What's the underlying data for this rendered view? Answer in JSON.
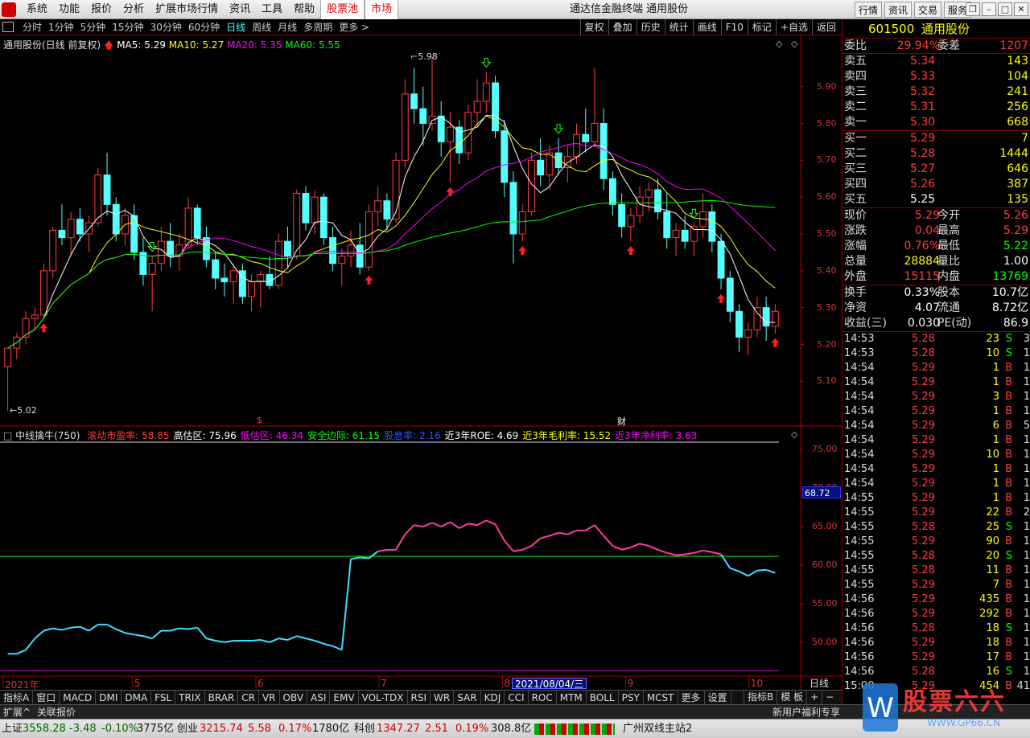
{
  "menu": {
    "items": [
      "系统",
      "功能",
      "报价",
      "分析",
      "扩展市场行情",
      "资讯",
      "工具",
      "帮助",
      "股票池",
      "市场"
    ],
    "red_items": [
      "股票池",
      "市场"
    ],
    "app_title": "通达信金融终端  通用股份",
    "right_buttons": [
      "行情",
      "资讯",
      "交易",
      "服务"
    ],
    "window_controls": [
      "restore-icon",
      "minimize-icon",
      "maximize-icon",
      "close-icon"
    ]
  },
  "periods": [
    "分时",
    "1分钟",
    "5分钟",
    "15分钟",
    "30分钟",
    "60分钟",
    "日线",
    "周线",
    "月线",
    "多周期",
    "更多 >"
  ],
  "active_period": "日线",
  "right_tools": [
    "复权",
    "叠加",
    "历史",
    "统计",
    "画线",
    "F10",
    "标记",
    "+自选",
    "返回"
  ],
  "chart_header": {
    "title": "通用股份(日线 前复权)",
    "ma5_label": "MA5: 5.29",
    "ma10_label": "MA10: 5.27",
    "ma20_label": "MA20: 5.35",
    "ma60_label": "MA60: 5.55",
    "colors": {
      "ma5": "#ffffff",
      "ma10": "#ffff00",
      "ma20": "#ff00ff",
      "ma60": "#00ff00"
    }
  },
  "price_axis": [
    "5.90",
    "5.80",
    "5.70",
    "5.60",
    "5.50",
    "5.40",
    "5.30",
    "5.20",
    "5.10"
  ],
  "annotations": {
    "high": "5.98",
    "low": "5.02",
    "marker_s": "$",
    "marker_cai": "财"
  },
  "indicator_header": {
    "name": "中线擒牛(750)",
    "items": [
      {
        "label": "滚动市盈率: 58.85",
        "color": "#ff3c3c"
      },
      {
        "label": "高估区: 75.96",
        "color": "#ffffff"
      },
      {
        "label": "低估区: 46.34",
        "color": "#ff00ff"
      },
      {
        "label": "安全边际: 61.15",
        "color": "#00ff00"
      },
      {
        "label": "股息率: 2.16",
        "color": "#3050ff"
      },
      {
        "label": "近3年ROE: 4.69",
        "color": "#ffffff"
      },
      {
        "label": "近3年毛利率: 15.52",
        "color": "#ffff00"
      },
      {
        "label": "近3年净利率: 3.63",
        "color": "#ff00ff"
      }
    ]
  },
  "indicator_axis": [
    "75.00",
    "70.00",
    "65.00",
    "60.00",
    "55.00",
    "50.00"
  ],
  "indicator_current": "68.72",
  "date_axis": [
    {
      "label": "2021年",
      "month": 3.95
    },
    {
      "label": "5",
      "month": 5
    },
    {
      "label": "6",
      "month": 6
    },
    {
      "label": "7",
      "month": 7
    },
    {
      "label": "8",
      "month": 8
    },
    {
      "label": "9",
      "month": 9
    },
    {
      "label": "10",
      "month": 10
    }
  ],
  "cursor_date": "2021/08/04/三",
  "period_mode": "日线",
  "chart_data": {
    "type": "candlestick",
    "ylim": [
      5.02,
      5.98
    ],
    "candles": [
      [
        5.14,
        5.19,
        5.02,
        5.19
      ],
      [
        5.19,
        5.23,
        5.16,
        5.22
      ],
      [
        5.22,
        5.29,
        5.2,
        5.27
      ],
      [
        5.27,
        5.3,
        5.24,
        5.28
      ],
      [
        5.28,
        5.42,
        5.27,
        5.4
      ],
      [
        5.4,
        5.52,
        5.38,
        5.51
      ],
      [
        5.51,
        5.58,
        5.47,
        5.49
      ],
      [
        5.49,
        5.56,
        5.44,
        5.54
      ],
      [
        5.54,
        5.57,
        5.48,
        5.5
      ],
      [
        5.5,
        5.55,
        5.45,
        5.53
      ],
      [
        5.53,
        5.68,
        5.52,
        5.66
      ],
      [
        5.66,
        5.72,
        5.55,
        5.58
      ],
      [
        5.58,
        5.6,
        5.48,
        5.5
      ],
      [
        5.5,
        5.57,
        5.47,
        5.55
      ],
      [
        5.55,
        5.58,
        5.43,
        5.45
      ],
      [
        5.45,
        5.49,
        5.36,
        5.39
      ],
      [
        5.39,
        5.44,
        5.29,
        5.42
      ],
      [
        5.42,
        5.52,
        5.4,
        5.48
      ],
      [
        5.48,
        5.53,
        5.41,
        5.44
      ],
      [
        5.44,
        5.5,
        5.4,
        5.47
      ],
      [
        5.47,
        5.6,
        5.46,
        5.57
      ],
      [
        5.57,
        5.58,
        5.47,
        5.49
      ],
      [
        5.49,
        5.52,
        5.41,
        5.43
      ],
      [
        5.43,
        5.45,
        5.35,
        5.38
      ],
      [
        5.38,
        5.42,
        5.33,
        5.37
      ],
      [
        5.37,
        5.42,
        5.31,
        5.4
      ],
      [
        5.4,
        5.42,
        5.31,
        5.33
      ],
      [
        5.33,
        5.39,
        5.29,
        5.37
      ],
      [
        5.37,
        5.4,
        5.3,
        5.39
      ],
      [
        5.39,
        5.44,
        5.35,
        5.36
      ],
      [
        5.36,
        5.5,
        5.35,
        5.48
      ],
      [
        5.48,
        5.52,
        5.41,
        5.44
      ],
      [
        5.44,
        5.62,
        5.43,
        5.61
      ],
      [
        5.61,
        5.63,
        5.51,
        5.53
      ],
      [
        5.53,
        5.62,
        5.5,
        5.6
      ],
      [
        5.6,
        5.61,
        5.47,
        5.49
      ],
      [
        5.49,
        5.52,
        5.4,
        5.42
      ],
      [
        5.42,
        5.46,
        5.36,
        5.44
      ],
      [
        5.44,
        5.51,
        5.41,
        5.47
      ],
      [
        5.47,
        5.53,
        5.39,
        5.41
      ],
      [
        5.41,
        5.58,
        5.4,
        5.56
      ],
      [
        5.56,
        5.63,
        5.52,
        5.59
      ],
      [
        5.59,
        5.61,
        5.51,
        5.54
      ],
      [
        5.54,
        5.72,
        5.53,
        5.7
      ],
      [
        5.7,
        5.92,
        5.68,
        5.88
      ],
      [
        5.88,
        5.95,
        5.8,
        5.84
      ],
      [
        5.84,
        5.9,
        5.74,
        5.8
      ],
      [
        5.8,
        5.98,
        5.78,
        5.82
      ],
      [
        5.82,
        5.86,
        5.71,
        5.75
      ],
      [
        5.75,
        5.83,
        5.64,
        5.79
      ],
      [
        5.79,
        5.81,
        5.69,
        5.72
      ],
      [
        5.72,
        5.85,
        5.7,
        5.83
      ],
      [
        5.83,
        5.92,
        5.79,
        5.86
      ],
      [
        5.86,
        5.94,
        5.83,
        5.91
      ],
      [
        5.91,
        5.93,
        5.76,
        5.78
      ],
      [
        5.78,
        5.81,
        5.6,
        5.64
      ],
      [
        5.64,
        5.67,
        5.42,
        5.5
      ],
      [
        5.5,
        5.58,
        5.48,
        5.56
      ],
      [
        5.56,
        5.72,
        5.55,
        5.7
      ],
      [
        5.7,
        5.76,
        5.63,
        5.66
      ],
      [
        5.66,
        5.74,
        5.62,
        5.72
      ],
      [
        5.72,
        5.76,
        5.66,
        5.68
      ],
      [
        5.68,
        5.74,
        5.64,
        5.71
      ],
      [
        5.71,
        5.8,
        5.69,
        5.77
      ],
      [
        5.77,
        5.84,
        5.72,
        5.75
      ],
      [
        5.75,
        5.95,
        5.74,
        5.8
      ],
      [
        5.8,
        5.84,
        5.62,
        5.65
      ],
      [
        5.65,
        5.67,
        5.55,
        5.58
      ],
      [
        5.58,
        5.61,
        5.49,
        5.52
      ],
      [
        5.52,
        5.57,
        5.48,
        5.55
      ],
      [
        5.55,
        5.63,
        5.53,
        5.6
      ],
      [
        5.6,
        5.64,
        5.56,
        5.62
      ],
      [
        5.62,
        5.65,
        5.54,
        5.56
      ],
      [
        5.56,
        5.61,
        5.46,
        5.49
      ],
      [
        5.49,
        5.53,
        5.44,
        5.51
      ],
      [
        5.51,
        5.55,
        5.46,
        5.48
      ],
      [
        5.48,
        5.53,
        5.44,
        5.52
      ],
      [
        5.52,
        5.61,
        5.49,
        5.56
      ],
      [
        5.56,
        5.58,
        5.45,
        5.48
      ],
      [
        5.48,
        5.5,
        5.35,
        5.38
      ],
      [
        5.38,
        5.4,
        5.26,
        5.29
      ],
      [
        5.29,
        5.31,
        5.18,
        5.22
      ],
      [
        5.22,
        5.26,
        5.17,
        5.24
      ],
      [
        5.24,
        5.33,
        5.22,
        5.3
      ],
      [
        5.3,
        5.33,
        5.21,
        5.25
      ],
      [
        5.25,
        5.31,
        5.23,
        5.29
      ]
    ],
    "series": [
      {
        "name": "MA5",
        "color": "#ffffff"
      },
      {
        "name": "MA10",
        "color": "#ffff00"
      },
      {
        "name": "MA20",
        "color": "#ff00ff"
      },
      {
        "name": "MA60",
        "color": "#00ff00"
      }
    ],
    "indicator_series": {
      "name": "中线擒牛",
      "ylim": [
        46.34,
        75.96
      ],
      "safety_line": 61.15,
      "values": [
        48.5,
        48.5,
        49.0,
        50.5,
        51.5,
        51.8,
        51.6,
        51.9,
        52.0,
        51.5,
        52.3,
        52.3,
        51.7,
        51.2,
        51.0,
        50.8,
        50.5,
        51.5,
        51.5,
        51.8,
        51.7,
        51.9,
        50.5,
        50.2,
        50.0,
        50.2,
        50.2,
        50.2,
        50.3,
        50.0,
        50.5,
        50.3,
        50.8,
        50.5,
        50.2,
        49.8,
        49.5,
        49.0,
        60.8,
        61.0,
        60.9,
        61.8,
        62.0,
        62.0,
        64.0,
        65.2,
        65.0,
        65.5,
        65.0,
        65.6,
        64.8,
        65.4,
        65.2,
        65.8,
        65.3,
        63.2,
        61.8,
        62.0,
        62.5,
        63.5,
        63.8,
        64.2,
        64.0,
        64.5,
        64.5,
        65.2,
        63.8,
        62.5,
        62.0,
        62.3,
        62.8,
        62.5,
        62.0,
        61.6,
        61.3,
        61.4,
        61.6,
        61.9,
        61.7,
        61.4,
        59.6,
        59.2,
        58.6,
        59.3,
        59.4,
        59.0
      ]
    }
  },
  "quote": {
    "code": "601500",
    "name": "通用股份",
    "weibi_label": "委比",
    "weibi": "29.94%",
    "weicha_label": "委差",
    "weicha": "1207",
    "asks": [
      {
        "label": "卖五",
        "price": "5.34",
        "vol": "143"
      },
      {
        "label": "卖四",
        "price": "5.33",
        "vol": "104"
      },
      {
        "label": "卖三",
        "price": "5.32",
        "vol": "241"
      },
      {
        "label": "卖二",
        "price": "5.31",
        "vol": "256"
      },
      {
        "label": "卖一",
        "price": "5.30",
        "vol": "668"
      }
    ],
    "bids": [
      {
        "label": "买一",
        "price": "5.29",
        "vol": "7"
      },
      {
        "label": "买二",
        "price": "5.28",
        "vol": "1444"
      },
      {
        "label": "买三",
        "price": "5.27",
        "vol": "646"
      },
      {
        "label": "买四",
        "price": "5.26",
        "vol": "387"
      },
      {
        "label": "买五",
        "price": "5.25",
        "vol": "135"
      }
    ],
    "stats1": [
      {
        "l": "现价",
        "v": "5.29",
        "c": "red",
        "l2": "今开",
        "v2": "5.26",
        "c2": "red"
      },
      {
        "l": "涨跌",
        "v": "0.04",
        "c": "red",
        "l2": "最高",
        "v2": "5.29",
        "c2": "red"
      },
      {
        "l": "涨幅",
        "v": "0.76%",
        "c": "red",
        "l2": "最低",
        "v2": "5.22",
        "c2": "grn"
      },
      {
        "l": "总量",
        "v": "28884",
        "c": "yel",
        "l2": "量比",
        "v2": "1.00",
        "c2": "wht"
      },
      {
        "l": "外盘",
        "v": "15115",
        "c": "red",
        "l2": "内盘",
        "v2": "13769",
        "c2": "grn"
      }
    ],
    "stats2": [
      {
        "l": "换手",
        "v": "0.33%",
        "c": "wht",
        "l2": "股本",
        "v2": "10.7亿",
        "c2": "wht"
      },
      {
        "l": "净资",
        "v": "4.07",
        "c": "wht",
        "l2": "流通",
        "v2": "8.72亿",
        "c2": "wht"
      },
      {
        "l": "收益(三)",
        "v": "0.030",
        "c": "wht",
        "l2": "PE(动)",
        "v2": "86.9",
        "c2": "wht"
      }
    ],
    "ticks": [
      [
        "14:53",
        "5.28",
        "23",
        "S",
        "3"
      ],
      [
        "14:53",
        "5.28",
        "10",
        "S",
        "1"
      ],
      [
        "14:54",
        "5.29",
        "1",
        "B",
        "1"
      ],
      [
        "14:54",
        "5.29",
        "1",
        "B",
        "1"
      ],
      [
        "14:54",
        "5.29",
        "3",
        "B",
        "1"
      ],
      [
        "14:54",
        "5.29",
        "1",
        "B",
        "1"
      ],
      [
        "14:54",
        "5.29",
        "6",
        "B",
        "5"
      ],
      [
        "14:54",
        "5.29",
        "1",
        "B",
        "1"
      ],
      [
        "14:54",
        "5.29",
        "10",
        "B",
        "1"
      ],
      [
        "14:54",
        "5.29",
        "1",
        "B",
        "1"
      ],
      [
        "14:54",
        "5.29",
        "1",
        "B",
        "1"
      ],
      [
        "14:55",
        "5.29",
        "1",
        "B",
        "1"
      ],
      [
        "14:55",
        "5.29",
        "22",
        "B",
        "2"
      ],
      [
        "14:55",
        "5.28",
        "25",
        "S",
        "1"
      ],
      [
        "14:55",
        "5.29",
        "90",
        "B",
        "1"
      ],
      [
        "14:55",
        "5.28",
        "20",
        "S",
        "1"
      ],
      [
        "14:55",
        "5.28",
        "11",
        "B",
        "1"
      ],
      [
        "14:55",
        "5.29",
        "7",
        "B",
        "1"
      ],
      [
        "14:56",
        "5.29",
        "435",
        "B",
        "1"
      ],
      [
        "14:56",
        "5.29",
        "292",
        "B",
        "1"
      ],
      [
        "14:56",
        "5.28",
        "18",
        "S",
        "1"
      ],
      [
        "14:56",
        "5.29",
        "18",
        "B",
        "1"
      ],
      [
        "14:56",
        "5.29",
        "17",
        "B",
        "1"
      ],
      [
        "14:56",
        "5.28",
        "16",
        "S",
        "1"
      ],
      [
        "15:00",
        "5.29",
        "454",
        "B",
        "41"
      ]
    ]
  },
  "indicator_tabs": [
    "指标A",
    "窗口",
    "MACD",
    "DMI",
    "DMA",
    "FSL",
    "TRIX",
    "BRAR",
    "CR",
    "VR",
    "OBV",
    "ASI",
    "EMV",
    "VOL-TDX",
    "RSI",
    "WR",
    "SAR",
    "KDJ",
    "CCI",
    "ROC",
    "MTM",
    "BOLL",
    "PSY",
    "MCST",
    "更多",
    "设置"
  ],
  "indicator_tabs_right": [
    "指标B",
    "模 板",
    "+",
    "−"
  ],
  "ext_bar": {
    "left1": "扩展^",
    "left2": "关联报价",
    "right": "新用户福利专享"
  },
  "status": {
    "sh_label": "上证",
    "sh_val": "3558.28",
    "sh_chg": "-3.48",
    "sh_pct": "-0.10%",
    "sh_amt": "3775亿",
    "cy_label": "创业",
    "cy_val": "3215.74",
    "cy_chg": "5.58",
    "cy_pct": "0.17%",
    "cy_amt": "1780亿",
    "kc_label": "科创",
    "kc_val": "1347.27",
    "kc_chg": "2.51",
    "kc_pct": "0.19%",
    "kc_amt": "308.8亿",
    "server": "广州双线主站2"
  },
  "watermark": {
    "text": "股票六六",
    "url": "WWW.GP66.CN"
  }
}
